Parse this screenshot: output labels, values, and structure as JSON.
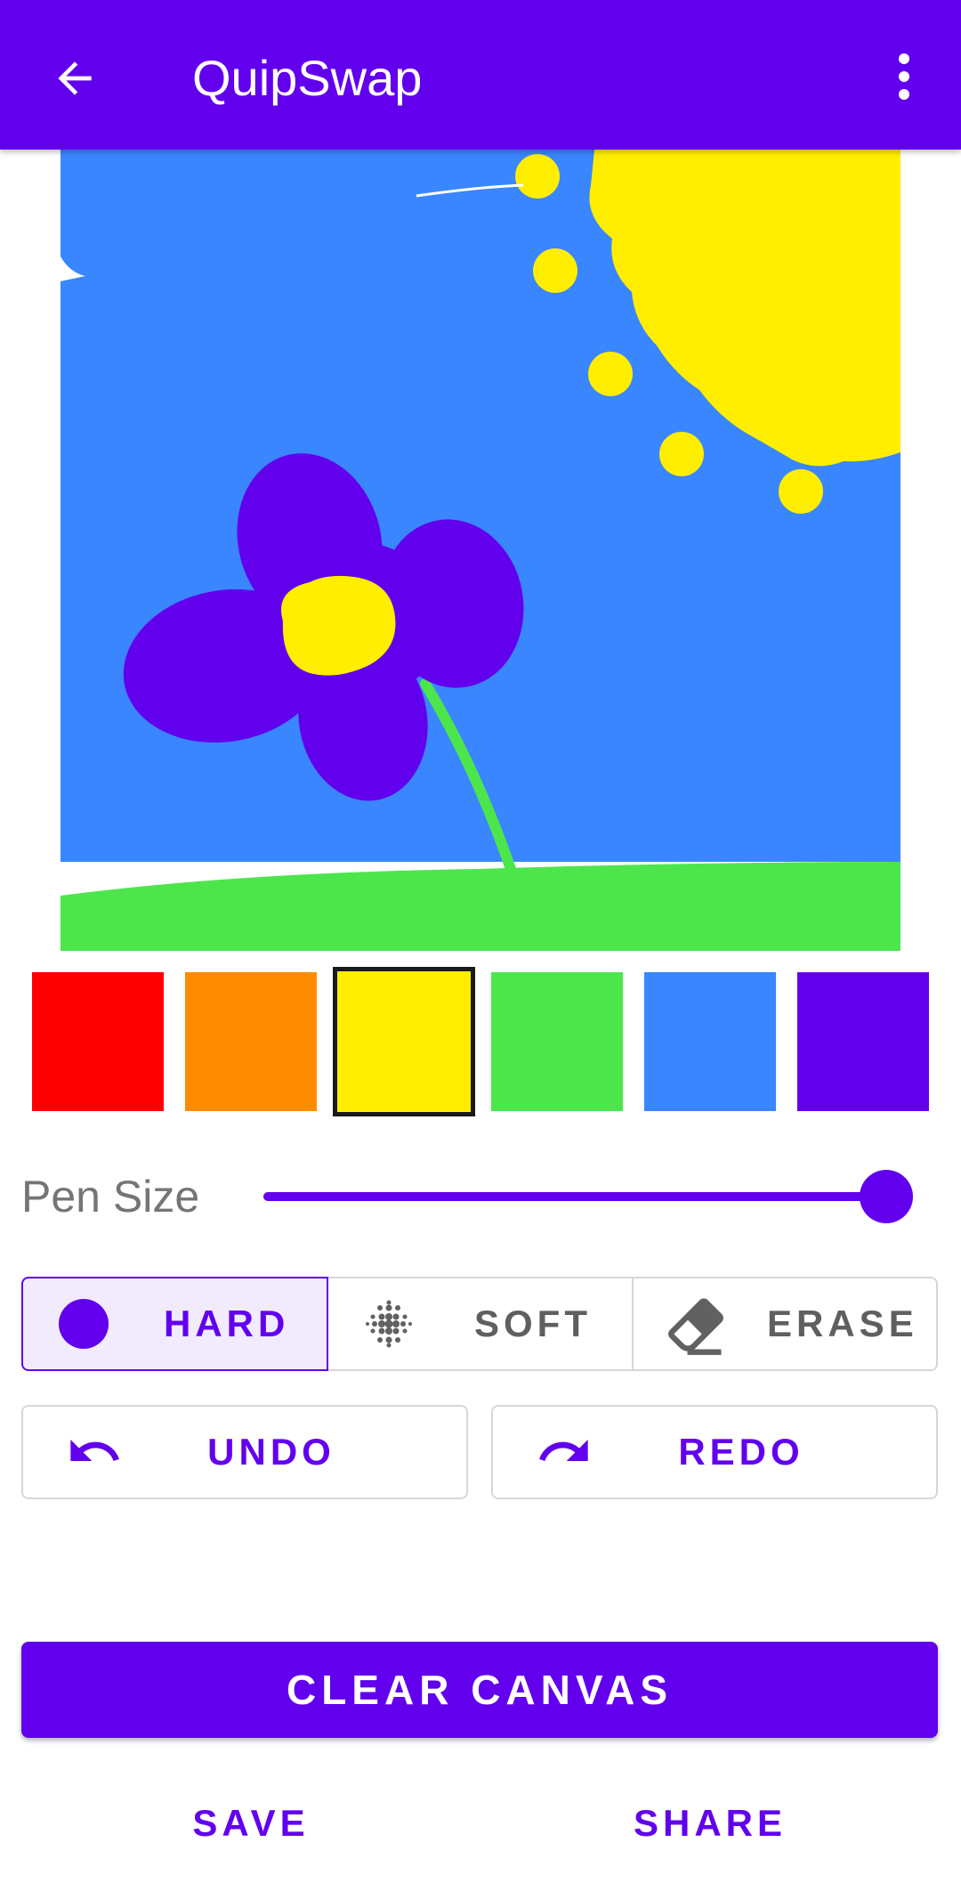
{
  "app_bar": {
    "title": "QuipSwap",
    "back_icon": "arrow-back-icon",
    "menu_icon": "more-vert-icon"
  },
  "palette": {
    "selected": "yellow",
    "colors": [
      {
        "name": "red",
        "hex": "#ff0000"
      },
      {
        "name": "orange",
        "hex": "#ff8c00"
      },
      {
        "name": "yellow",
        "hex": "#ffee00"
      },
      {
        "name": "green",
        "hex": "#4ce64c"
      },
      {
        "name": "blue",
        "hex": "#3a86ff"
      },
      {
        "name": "purple",
        "hex": "#6200ee"
      }
    ]
  },
  "pen_size": {
    "label": "Pen Size",
    "value_fraction": 1.0
  },
  "brush_modes": {
    "selected": "hard",
    "hard": "HARD",
    "soft": "SOFT",
    "erase": "ERASE"
  },
  "history": {
    "undo": "UNDO",
    "redo": "REDO"
  },
  "actions": {
    "clear": "CLEAR CANVAS",
    "save": "SAVE",
    "share": "SHARE"
  },
  "colors": {
    "accent": "#6200ee",
    "sky": "#3a86ff",
    "sun": "#ffee00",
    "grass": "#4ce64c"
  }
}
